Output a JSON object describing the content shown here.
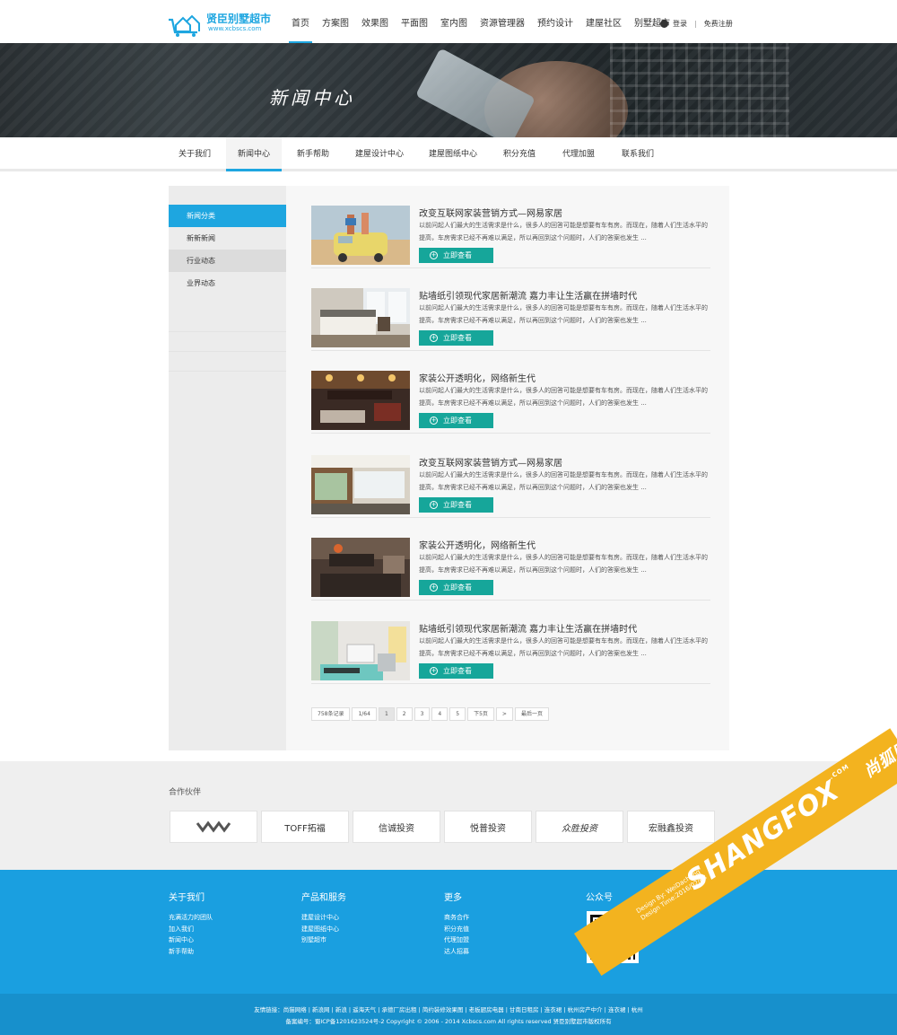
{
  "header": {
    "logo_text": "贤臣别墅超市",
    "logo_url": "www.xcbscs.com",
    "nav": [
      "首页",
      "方案图",
      "效果图",
      "平面图",
      "室内图",
      "资源管理器",
      "预约设计",
      "建屋社区",
      "别墅超市"
    ],
    "login": "登录",
    "register": "免费注册"
  },
  "banner": {
    "title": "新闻中心"
  },
  "subnav": [
    "关于我们",
    "新闻中心",
    "新手帮助",
    "建屋设计中心",
    "建屋图纸中心",
    "积分充值",
    "代理加盟",
    "联系我们"
  ],
  "sidebar": {
    "items": [
      "新闻分类",
      "新新新闻",
      "行业动态",
      "业界动态"
    ]
  },
  "news": [
    {
      "title": "改变互联网家装营销方式—网易家居",
      "desc": "以前问起人们最大的生活需求是什么，很多人的回答可能是想要有车有房。而现在，随着人们生活水平的提高，车房需求已经不再难以满足，所以再回到这个问题时，人们的答案也发生 ...",
      "button": "立即查看"
    },
    {
      "title": "贴墙纸引领现代家居新潮流 嘉力丰让生活赢在拼墙时代",
      "desc": "以前问起人们最大的生活需求是什么，很多人的回答可能是想要有车有房。而现在，随着人们生活水平的提高，车房需求已经不再难以满足，所以再回到这个问题时，人们的答案也发生 ...",
      "button": "立即查看"
    },
    {
      "title": "家装公开透明化，网络新生代",
      "desc": "以前问起人们最大的生活需求是什么，很多人的回答可能是想要有车有房。而现在，随着人们生活水平的提高，车房需求已经不再难以满足，所以再回到这个问题时，人们的答案也发生 ...",
      "button": "立即查看"
    },
    {
      "title": "改变互联网家装营销方式—网易家居",
      "desc": "以前问起人们最大的生活需求是什么，很多人的回答可能是想要有车有房。而现在，随着人们生活水平的提高，车房需求已经不再难以满足，所以再回到这个问题时，人们的答案也发生 ...",
      "button": "立即查看"
    },
    {
      "title": "家装公开透明化，网络新生代",
      "desc": "以前问起人们最大的生活需求是什么，很多人的回答可能是想要有车有房。而现在，随着人们生活水平的提高，车房需求已经不再难以满足，所以再回到这个问题时，人们的答案也发生 ...",
      "button": "立即查看"
    },
    {
      "title": "贴墙纸引领现代家居新潮流 嘉力丰让生活赢在拼墙时代",
      "desc": "以前问起人们最大的生活需求是什么，很多人的回答可能是想要有车有房。而现在，随着人们生活水平的提高，车房需求已经不再难以满足，所以再回到这个问题时，人们的答案也发生 ...",
      "button": "立即查看"
    }
  ],
  "pager": [
    "758条记录",
    "1/64",
    "1",
    "2",
    "3",
    "4",
    "5",
    "下5页",
    ">",
    "最后一页"
  ],
  "partners": {
    "label": "合作伙伴",
    "logos": [
      "",
      "TOFF拓福",
      "信诚投资",
      "悦普投资",
      "众胜投资",
      "宏融鑫投资"
    ]
  },
  "footer": {
    "col1": {
      "title": "关于我们",
      "links": [
        "充满活力的团队",
        "加入我们",
        "新闻中心",
        "新手帮助"
      ]
    },
    "col2": {
      "title": "产品和服务",
      "links": [
        "建屋设计中心",
        "建屋图纸中心",
        "别墅超市"
      ]
    },
    "col3": {
      "title": "更多",
      "links": [
        "商务合作",
        "积分充值",
        "代理加盟",
        "达人招募"
      ]
    },
    "col4": {
      "title": "公众号"
    },
    "links_row": "友情链接：尚猫网络 | 新浪网 | 新浪 | 遥海天气 | 承德厂房出租 | 简约装修效果图 | 老板厨房电器 | 甘南日租房 | 连衣裙 | 杭州房产中介 | 连衣裙 | 杭州",
    "copyright": "备案编号：蜀ICP备12016235​24号-2 Copyright © 2006 - 2014 Xcbscs.com All rights reserved 贤臣别墅超市版权所有"
  },
  "watermark": {
    "brand": "SHANGFOX",
    "brand_cn": "尚狐网络",
    "design_by": "Design By: WeiDacheng",
    "design_time": "Design Time:2016/02/03",
    "com": ".COM"
  }
}
